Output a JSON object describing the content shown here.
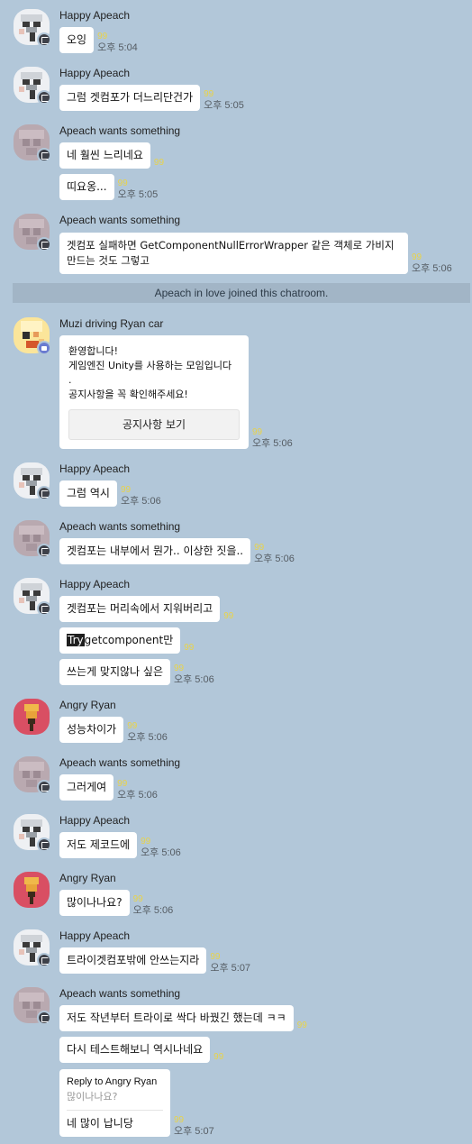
{
  "colors": {
    "background": "#b2c7d9",
    "unread": "#e8d34a",
    "system_bar": "#a2b5c6"
  },
  "system_message": "Apeach in love joined this chatroom.",
  "groups": [
    {
      "sender": "Happy Apeach",
      "messages": [
        {
          "text": "오잉",
          "unread": "99",
          "time": "오후 5:04"
        }
      ]
    },
    {
      "sender": "Happy Apeach",
      "messages": [
        {
          "text": "그럼 겟컴포가 더느리단건가",
          "unread": "99",
          "time": "오후 5:05"
        }
      ]
    },
    {
      "sender": "Apeach wants something",
      "messages": [
        {
          "text": "네 훨씬 느리네요",
          "unread": "99"
        },
        {
          "text": "띠요옹...",
          "unread": "99",
          "time": "오후 5:05"
        }
      ]
    },
    {
      "sender": "Apeach wants something",
      "messages": [
        {
          "text": "겟컴포 실패하면 GetComponentNullErrorWrapper 같은 객체로 가비지 만드는 것도 그렇고",
          "unread": "99",
          "time": "오후 5:06"
        }
      ]
    },
    {
      "sender": "Muzi driving Ryan car",
      "messages": [
        {
          "notice_lines": "환영합니다!\n게임엔진 Unity를 사용하는 모임입니다\n.\n공지사항을 꼭 확인해주세요!",
          "button": "공지사항 보기",
          "unread": "99",
          "time": "오후 5:06"
        }
      ]
    },
    {
      "sender": "Happy Apeach",
      "messages": [
        {
          "text": "그럼 역시",
          "unread": "99",
          "time": "오후 5:06"
        }
      ]
    },
    {
      "sender": "Apeach wants something",
      "messages": [
        {
          "text": "겟컴포는 내부에서 뭔가.. 이상한 짓을..",
          "unread": "99",
          "time": "오후 5:06"
        }
      ]
    },
    {
      "sender": "Happy Apeach",
      "messages": [
        {
          "text": "겟컴포는 머리속에서 지워버리고",
          "unread": "99"
        },
        {
          "highlight": "Try",
          "text": "getcomponent만",
          "unread": "99"
        },
        {
          "text": "쓰는게 맞지않나 싶은",
          "unread": "99",
          "time": "오후 5:06"
        }
      ]
    },
    {
      "sender": "Angry Ryan",
      "messages": [
        {
          "text": "성능차이가",
          "unread": "99",
          "time": "오후 5:06"
        }
      ]
    },
    {
      "sender": "Apeach wants something",
      "messages": [
        {
          "text": "그러게여",
          "unread": "99",
          "time": "오후 5:06"
        }
      ]
    },
    {
      "sender": "Happy Apeach",
      "messages": [
        {
          "text": "저도 제코드에",
          "unread": "99",
          "time": "오후 5:06"
        }
      ]
    },
    {
      "sender": "Angry Ryan",
      "messages": [
        {
          "text": "많이나나요?",
          "unread": "99",
          "time": "오후 5:06"
        }
      ]
    },
    {
      "sender": "Happy Apeach",
      "messages": [
        {
          "text": "트라이겟컴포밖에 안쓰는지라",
          "unread": "99",
          "time": "오후 5:07"
        }
      ]
    },
    {
      "sender": "Apeach wants something",
      "messages": [
        {
          "text": "저도 작년부터 트라이로 싹다 바꿨긴 했는데 ㅋㅋ",
          "unread": "99"
        },
        {
          "text": "다시 테스트해보니 역시나네요",
          "unread": "99"
        },
        {
          "reply_to": "Reply to Angry Ryan",
          "quote": "많이나나요?",
          "text": "네 많이 납니당",
          "unread": "99",
          "time": "오후 5:07"
        }
      ]
    }
  ]
}
